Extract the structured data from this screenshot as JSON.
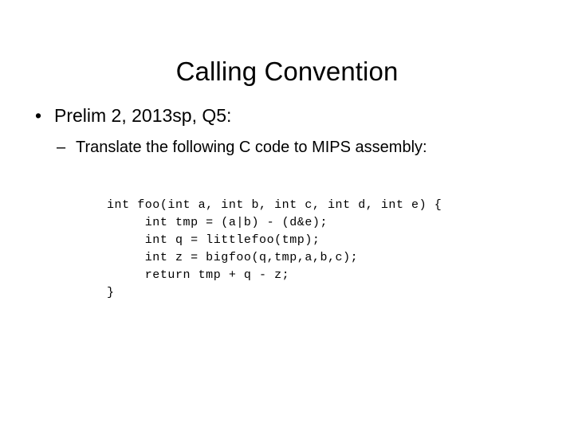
{
  "slide": {
    "title": "Calling Convention",
    "background_color": "#ffffff",
    "text_color": "#000000"
  },
  "bullets": {
    "level1": {
      "marker": "•",
      "text": "Prelim 2, 2013sp, Q5:"
    },
    "level2": {
      "marker": "–",
      "text": "Translate the following C code to MIPS assembly:"
    }
  },
  "code": {
    "language": "c",
    "lines": [
      "int foo(int a, int b, int c, int d, int e) {",
      "     int tmp = (a|b) - (d&e);",
      "     int q = littlefoo(tmp);",
      "     int z = bigfoo(q,tmp,a,b,c);",
      "     return tmp + q - z;",
      "}"
    ]
  }
}
